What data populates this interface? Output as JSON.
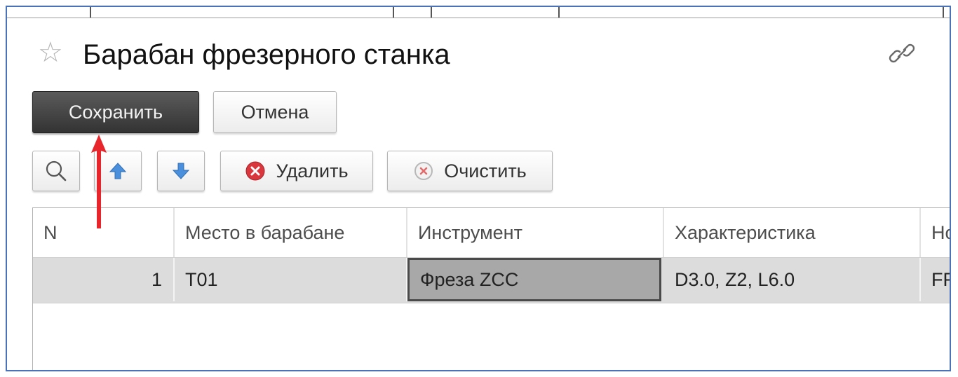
{
  "window": {
    "title": "Барабан фрезерного станка"
  },
  "icons": {
    "favorite": "star-outline-icon",
    "link": "link-icon",
    "search": "magnifier-icon",
    "move_up": "arrow-up-icon",
    "move_down": "arrow-down-icon",
    "delete": "red-cross-circle-icon",
    "clear": "gray-cross-circle-icon"
  },
  "actions": {
    "save_label": "Сохранить",
    "cancel_label": "Отмена"
  },
  "table_toolbar": {
    "delete_label": "Удалить",
    "clear_label": "Очистить"
  },
  "table": {
    "columns": [
      "N",
      "Место в барабане",
      "Инструмент",
      "Характеристика",
      "Но"
    ],
    "rows": [
      {
        "n": "1",
        "slot": "T01",
        "tool": "Фреза ZCC",
        "characteristic": "D3.0, Z2, L6.0",
        "extra": "FR"
      }
    ]
  },
  "colors": {
    "frame_border": "#4a72b8",
    "default_button": "#3f3f3f",
    "selected_row": "#dcdcdc",
    "active_cell": "#a8a8a8",
    "annotation_arrow": "#e8252b",
    "delete_icon": "#d9363e",
    "move_icon": "#4a8fdc"
  }
}
